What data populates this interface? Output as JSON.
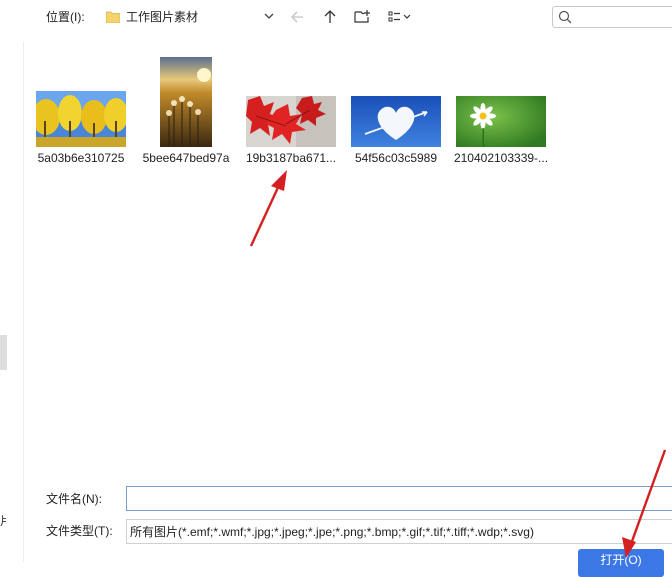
{
  "toolbar": {
    "location_label": "位置(I):",
    "current_folder": "工作图片素材",
    "search_placeholder": ""
  },
  "files": [
    {
      "name": "5a03b6e310725"
    },
    {
      "name": "5bee647bed97a"
    },
    {
      "name": "19b3187ba671..."
    },
    {
      "name": "54f56c03c5989"
    },
    {
      "name": "210402103339-..."
    }
  ],
  "form": {
    "filename_label": "文件名(N):",
    "filename_value": "",
    "filetype_label": "文件类型(T):",
    "filetype_value": "所有图片(*.emf;*.wmf;*.jpg;*.jpeg;*.jpe;*.png;*.bmp;*.gif;*.tif;*.tiff;*.wdp;*.svg)",
    "open_button": "打开(O)"
  },
  "nav": {
    "scrap_text": "片"
  },
  "colors": {
    "accent": "#3b78e6",
    "annotation_arrow": "#d42020"
  }
}
